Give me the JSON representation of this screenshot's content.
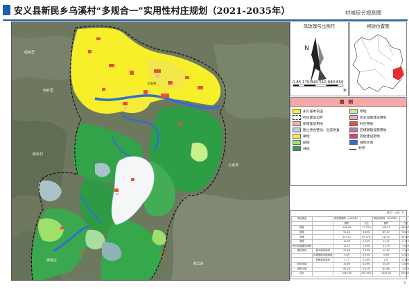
{
  "header": {
    "title": "安义县新民乡乌溪村“多规合一”实用性村庄规划（2021-2035年）",
    "subtitle": "村域综合规划图"
  },
  "map": {
    "place_labels": [
      "柏树里",
      "西岭里",
      "新岭村",
      "万家界",
      "新华岭",
      "杨家庄",
      "乌溪村"
    ]
  },
  "scale_panel": {
    "title": "风玫瑰与比例尺",
    "north": "N",
    "scale_numbers": "0 85 170 340 510 680 850",
    "scale_unit": "米"
  },
  "location_panel": {
    "title": "相对位置图"
  },
  "legend": {
    "title": "图例",
    "items": [
      {
        "label": "永久基本农田",
        "color": "#f7f22c"
      },
      {
        "label": "草地",
        "color": "#c8f08a"
      },
      {
        "label": "村庄建设边界",
        "color": "#ffffff"
      },
      {
        "label": "农业设施建设用地",
        "color": "#e8a8c8"
      },
      {
        "label": "新增建设用地",
        "color": "#f3b3b3"
      },
      {
        "label": "村庄用地",
        "color": "#e8503c"
      },
      {
        "label": "国土综合整治、生态修复",
        "color": "#d8e8f5"
      },
      {
        "label": "区域基础设施用地",
        "color": "#b07aa8"
      },
      {
        "label": "耕地",
        "color": "#f4e858"
      },
      {
        "label": "其他建设用地",
        "color": "#d3437b"
      },
      {
        "label": "园地",
        "color": "#9ee06a"
      },
      {
        "label": "陆地水域",
        "color": "#2f6fd0"
      },
      {
        "label": "林地",
        "color": "#2ea04a"
      },
      {
        "label": "村界",
        "color": "#222222"
      }
    ]
  },
  "table": {
    "unit": "单位：公顷、%",
    "rows": [
      [
        "用地类型",
        "",
        "规划基期年（2020年）",
        "",
        "规划目标年（2035年）",
        "",
        "变化量"
      ],
      [
        "",
        "",
        "面积",
        "占比",
        "面积",
        "占比",
        ""
      ],
      [
        "耕地",
        "",
        "108.40",
        "17.79%",
        "109.10",
        "18.00%",
        "0.70"
      ],
      [
        "园地",
        "",
        "90.16",
        "6.69%",
        "89.37",
        "6.61%",
        "-0.16"
      ],
      [
        "林地",
        "",
        "313.51",
        "49.17%",
        "312.61",
        "49.00%",
        "-0.99"
      ],
      [
        "草地",
        "",
        "13.45",
        "2.16%",
        "13.12",
        "2.11%",
        "-0.32"
      ],
      [
        "农业设施建设用地",
        "",
        "12.12",
        "1.99%",
        "11.79",
        "1.92%",
        "-0.31"
      ],
      [
        "建设用地",
        "城乡建设用地",
        "23.24",
        "7.43%",
        "14.12",
        "7.33%",
        "-3.00"
      ],
      [
        "",
        "区域基础设施用地",
        "0.89",
        "0.55%",
        "0.89",
        "0.55%",
        "0.00"
      ],
      [
        "",
        "其他建设用地",
        "1.71",
        "0.28%",
        "1.71",
        "0.28%",
        "0.00"
      ],
      [
        "陆地水域",
        "",
        "30.49",
        "4.09%",
        "30.49",
        "4.09%",
        "0.00"
      ],
      [
        "其他土地",
        "",
        "65.23",
        "0.91%",
        "65.68",
        "1.07%",
        "0.85"
      ],
      [
        "合计",
        "",
        "1044.06",
        "100.00%",
        "1044.04",
        "100.00%",
        "0.00"
      ]
    ]
  },
  "page_number": "3"
}
